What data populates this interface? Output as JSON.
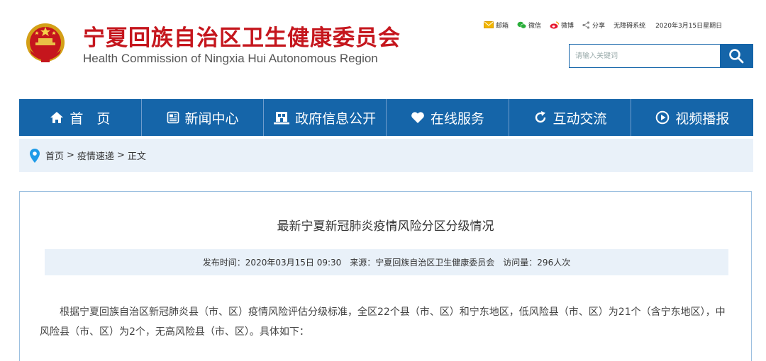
{
  "header": {
    "title_cn": "宁夏回族自治区卫生健康委员会",
    "title_en": "Health Commission of Ningxia Hui Autonomous Region",
    "links": {
      "mail": "邮箱",
      "wechat": "微信",
      "weibo": "微博",
      "share": "分享",
      "accessible": "无障碍系统"
    },
    "date": "2020年3月15日星期日",
    "search_placeholder": "请输入关键词",
    "brand_color": "#c5161d",
    "accent_color": "#1565a9"
  },
  "nav": {
    "home": "首　页",
    "news": "新闻中心",
    "gov_info": "政府信息公开",
    "online": "在线服务",
    "interact": "互动交流",
    "video": "视频播报"
  },
  "breadcrumb": {
    "home": "首页",
    "section": "疫情速递",
    "current": "正文",
    "separator": ">"
  },
  "article": {
    "title": "最新宁夏新冠肺炎疫情风险分区分级情况",
    "publish": "发布时间：2020年03月15日 09:30",
    "source": "来源：宁夏回族自治区卫生健康委员会",
    "views": "访问量：296人次",
    "paragraph": "根据宁夏回族自治区新冠肺炎县（市、区）疫情风险评估分级标准，全区22个县（市、区）和宁东地区，低风险县（市、区）为21个（含宁东地区），中风险县（市、区）为2个，无高风险县（市、区）。具体如下："
  }
}
